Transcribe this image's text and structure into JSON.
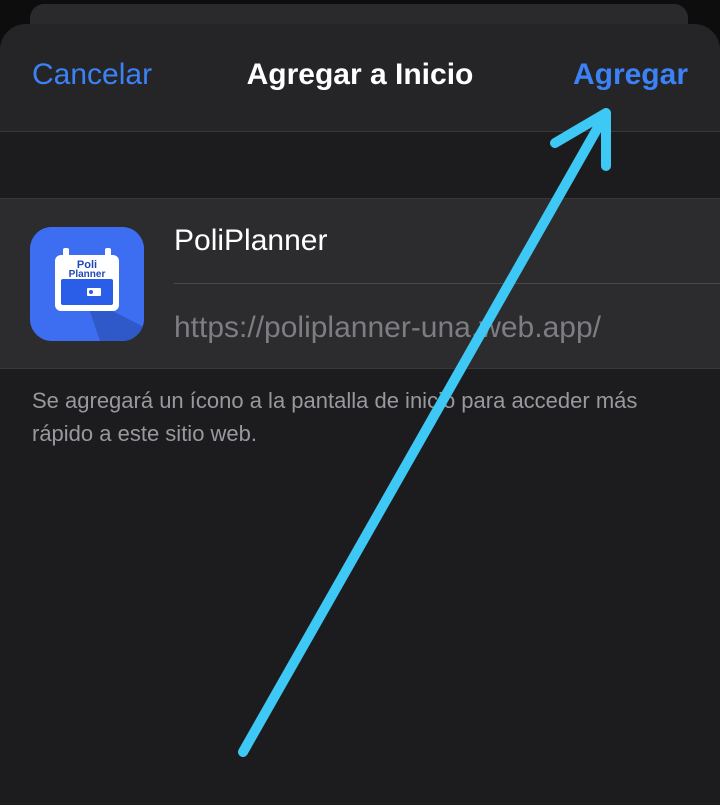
{
  "nav": {
    "cancel_label": "Cancelar",
    "title": "Agregar a Inicio",
    "add_label": "Agregar"
  },
  "app": {
    "icon_text_line1": "Poli",
    "icon_text_line2": "Planner",
    "name": "PoliPlanner",
    "url": "https://poliplanner-una.web.app/"
  },
  "footnote": "Se agregará un ícono a la pantalla de inicio para acceder más rápido a este sitio web.",
  "colors": {
    "accent": "#3b82f6",
    "annotation_arrow": "#3ec8f5",
    "sheet_bg": "#1c1c1e",
    "icon_bg": "#3d6df0"
  },
  "icons": {
    "app_icon": "calendar-icon",
    "annotation": "arrow-pointing-icon"
  }
}
